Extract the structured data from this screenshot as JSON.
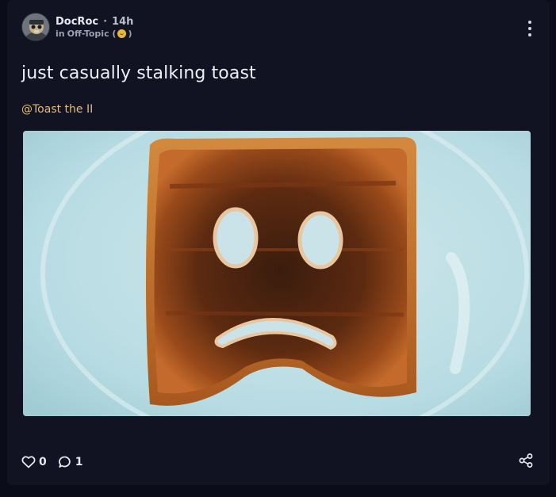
{
  "post": {
    "author": "DocRoc",
    "separator": "·",
    "time": "14h",
    "community_prefix": "in",
    "community": "Off-Topic",
    "community_icon": "smiley-face-icon",
    "title": "just casually stalking toast",
    "mention": "@Toast the II",
    "image_subject": "burnt-toast-sad-face-photo",
    "likes": "0",
    "comments": "1"
  },
  "colors": {
    "background": "#0b0c19",
    "card": "#111322",
    "mention": "#e5bc6d",
    "text": "#eceef6"
  }
}
